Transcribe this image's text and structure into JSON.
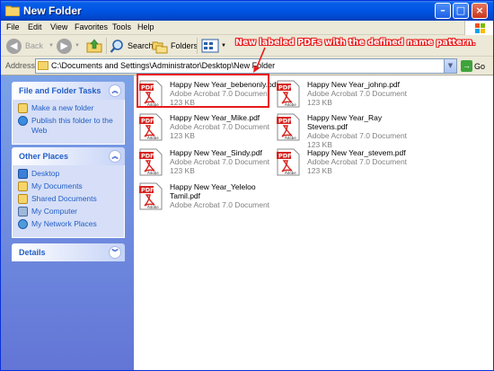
{
  "window": {
    "title": "New Folder"
  },
  "menu": {
    "items": [
      "File",
      "Edit",
      "View",
      "Favorites",
      "Tools",
      "Help"
    ]
  },
  "toolbar": {
    "back_label": "Back",
    "search_label": "Search",
    "folders_label": "Folders"
  },
  "address": {
    "label": "Address",
    "value": "C:\\Documents and Settings\\Administrator\\Desktop\\New Folder",
    "go_label": "Go"
  },
  "panels": {
    "file_tasks": {
      "title": "File and Folder Tasks",
      "links": [
        "Make a new folder",
        "Publish this folder to the Web"
      ]
    },
    "other_places": {
      "title": "Other Places",
      "links": [
        "Desktop",
        "My Documents",
        "Shared Documents",
        "My Computer",
        "My Network Places"
      ]
    },
    "details": {
      "title": "Details"
    }
  },
  "files": [
    {
      "name": "Happy New Year_bebenonly.pdf",
      "type": "Adobe Acrobat 7.0 Document",
      "size": "123 KB"
    },
    {
      "name": "Happy New Year_johnp.pdf",
      "type": "Adobe Acrobat 7.0 Document",
      "size": "123 KB"
    },
    {
      "name": "Happy New Year_Mike.pdf",
      "type": "Adobe Acrobat 7.0 Document",
      "size": "123 KB"
    },
    {
      "name": "Happy New Year_Ray",
      "name2": "Stevens.pdf",
      "type": "Adobe Acrobat 7.0 Document",
      "size": "123 KB"
    },
    {
      "name": "Happy New Year_Sindy.pdf",
      "type": "Adobe Acrobat 7.0 Document",
      "size": "123 KB"
    },
    {
      "name": "Happy New Year_stevem.pdf",
      "type": "Adobe Acrobat 7.0 Document",
      "size": "123 KB"
    },
    {
      "name": "Happy New Year_Yeleloo",
      "name2": "Tamil.pdf",
      "type": "Adobe Acrobat 7.0 Document"
    }
  ],
  "icon_label": "PDF",
  "icon_brand": "Adobe",
  "annotation": "New labeled PDFs with the defined name pattern.",
  "colors": {
    "accent": "#0054e3",
    "annotation": "#e81919",
    "link": "#215dc6"
  }
}
